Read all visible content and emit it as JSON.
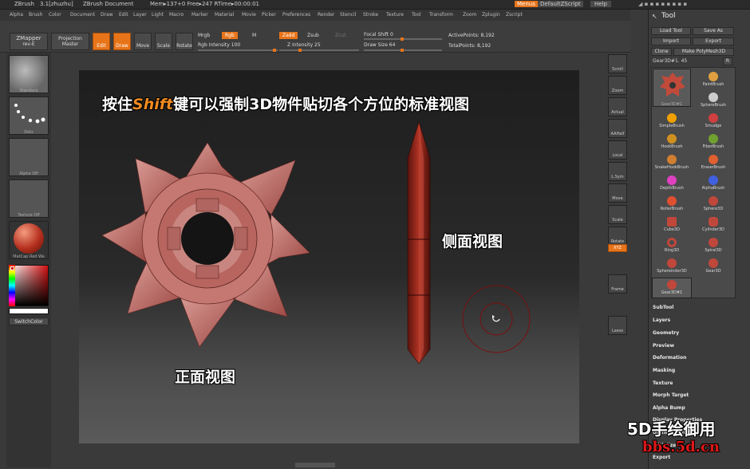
{
  "titlebar": {
    "app": "ZBrush",
    "version": "3.1[zhuzhu]",
    "document": "ZBrush Document",
    "mem": "Mem▸137+0 Free▸247 RTime▸00:00:01",
    "menus_button": "Menus",
    "script_button": "DefaultZScript",
    "help_button": "Help"
  },
  "menubar": [
    "Alpha",
    "Brush",
    "Color",
    "Document",
    "Draw",
    "Edit",
    "Layer",
    "Light",
    "Macro",
    "Marker",
    "Material",
    "Movie",
    "Picker",
    "Preferences",
    "Render",
    "Stencil",
    "Stroke",
    "Texture",
    "Tool",
    "Transform",
    "Zoom",
    "Zplugin",
    "Zscript"
  ],
  "toolbar": {
    "zmapper": "ZMapper",
    "zmapper_sub": "rev-E",
    "projection": "Projection",
    "master": "Master",
    "edit": "Edit",
    "draw": "Draw",
    "move": "Move",
    "scale": "Scale",
    "rotate": "Rotate",
    "mrgb": "Mrgb",
    "rgb": "Rgb",
    "m": "M",
    "rgb_intensity": "Rgb Intensity 100",
    "zadd": "Zadd",
    "zsub": "Zsub",
    "zcut": "Zcut",
    "z_intensity": "Z Intensity 25",
    "focal_shift": "Focal Shift 0",
    "draw_size": "Draw Size 64",
    "active_points": "ActivePoints: 8,192",
    "total_points": "TotalPoints: 8,192"
  },
  "leftshelf": {
    "standard": "Standard",
    "dots": "Dots",
    "alpha_off": "Alpha Off",
    "texture_off": "Texture Off",
    "matcap": "MatCap Red Wa",
    "switch_color": "SwitchColor"
  },
  "rightshelf": [
    "Scroll",
    "Zoom",
    "Actual",
    "AAHalf",
    "Local",
    "L.Sym",
    "Move",
    "Scale",
    "Rotate",
    "XYZ",
    "Frame",
    "Lasso"
  ],
  "toolpanel": {
    "title": "Tool",
    "load_tool": "Load Tool",
    "save_as": "Save As",
    "import": "Import",
    "export": "Export",
    "clone": "Clone",
    "make_polymesh": "Make PolyMesh3D",
    "current_tool": "Gear3D#1. 45",
    "r_button": "R",
    "tools": [
      "Gear3D#1",
      "PaintBrush",
      "SphereBrush",
      "SimpleBrush",
      "Smudge",
      "HookBrush",
      "FiberBrush",
      "SnakeHookBrush",
      "EraserBrush",
      "DepthBrush",
      "AlphaBrush",
      "RollerBrush",
      "Sphere3D",
      "Cube3D",
      "Cylinder3D",
      "Ring3D",
      "Spiral3D",
      "Sphereinder3D",
      "Gear3D",
      "Gear3D#1"
    ],
    "sections": [
      "SubTool",
      "Layers",
      "Geometry",
      "Preview",
      "Deformation",
      "Masking",
      "Texture",
      "Morph Target",
      "Alpha Bump",
      "Display Properties",
      "Unified Skin",
      "Initialize",
      "Export"
    ]
  },
  "canvas": {
    "headline_pre": "按住",
    "headline_key": "Shift",
    "headline_post": "键可以强制3D物件贴切各个方位的标准视图",
    "front_label": "正面视图",
    "side_label": "侧面视图"
  },
  "watermark": {
    "line1": "5D手绘御用",
    "line2": "bbs.5d.cn"
  },
  "colors": {
    "accent": "#e8741a",
    "gear": "#c97070",
    "headline_key": "#f08a20"
  }
}
